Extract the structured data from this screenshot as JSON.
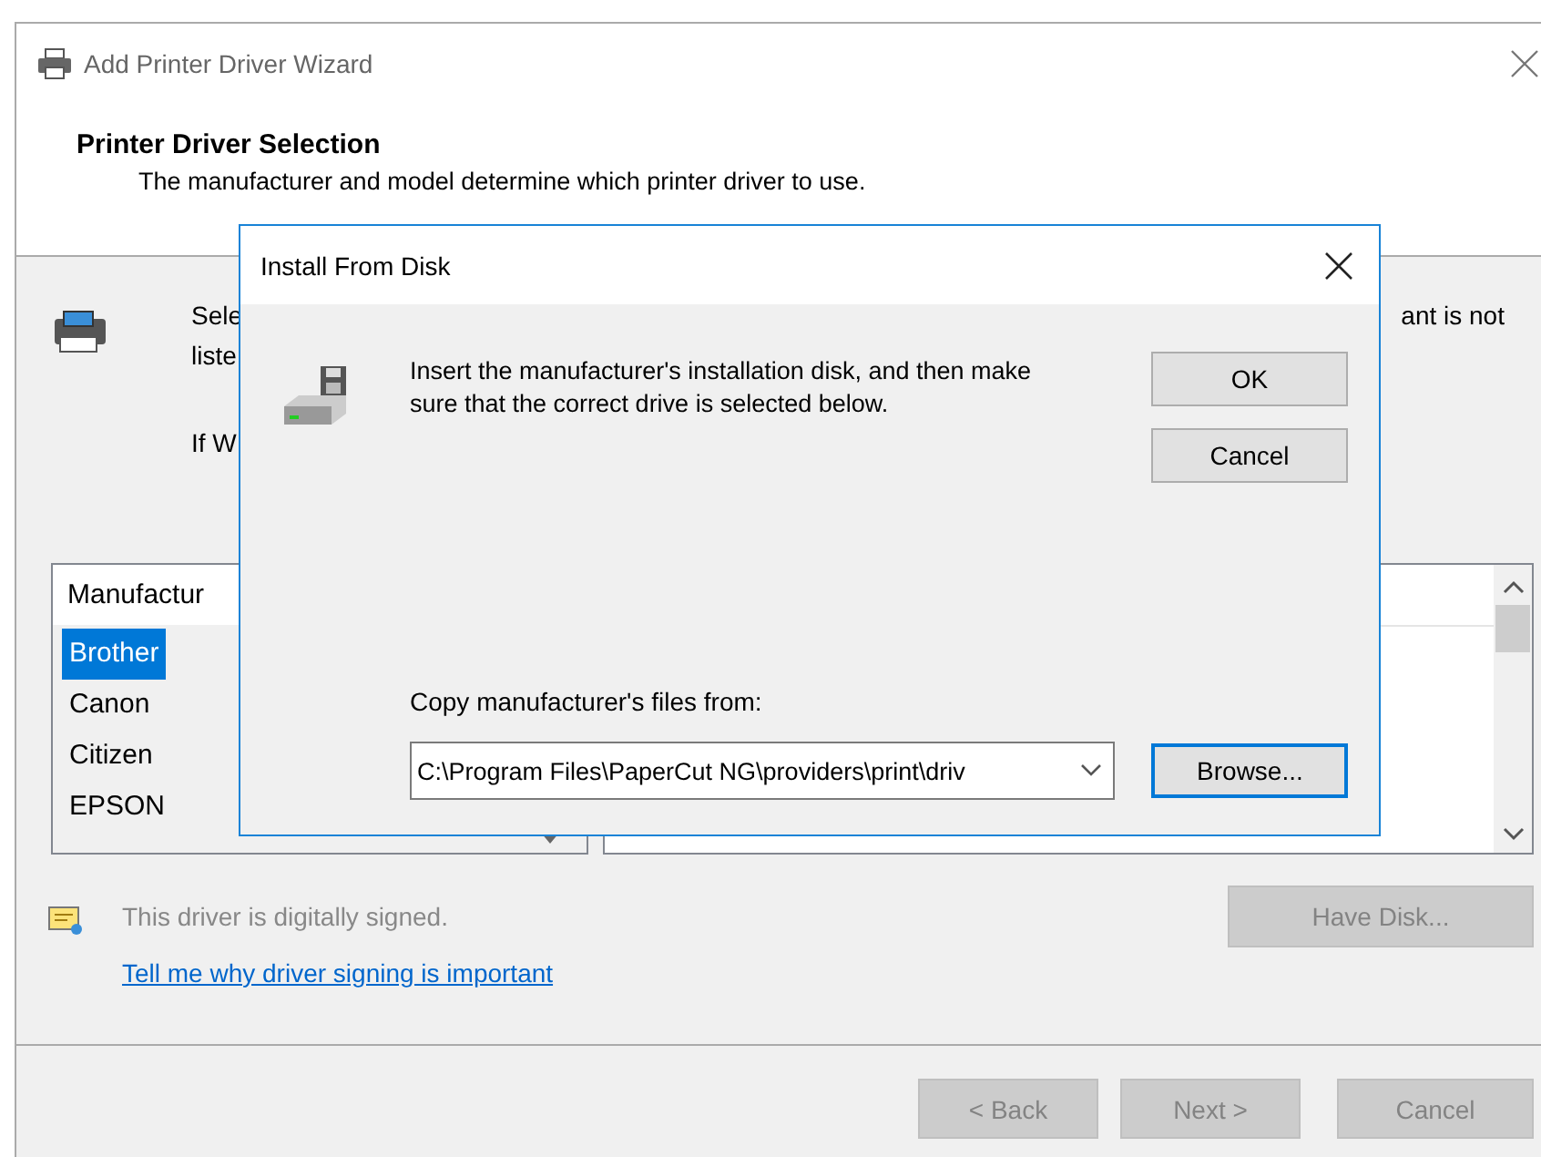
{
  "window": {
    "title": "Add Printer Driver Wizard"
  },
  "header": {
    "title": "Printer Driver Selection",
    "subtitle": "The manufacturer and model determine which printer driver to use."
  },
  "instructions": {
    "line_1_start": "Sele",
    "line_1_end": "ant is not",
    "line_2": "liste",
    "line_3": "If W"
  },
  "manufacturer_list": {
    "heading": "Manufactur",
    "items": [
      {
        "label": "Brother",
        "selected": true
      },
      {
        "label": "Canon",
        "selected": false
      },
      {
        "label": "Citizen",
        "selected": false
      },
      {
        "label": "EPSON",
        "selected": false
      }
    ]
  },
  "signature": {
    "text": "This driver is digitally signed.",
    "link": "Tell me why driver signing is important"
  },
  "have_disk_button": {
    "label": "Have Disk...",
    "disabled": true
  },
  "footer_buttons": [
    {
      "label": "< Back",
      "disabled": true
    },
    {
      "label": "Next >",
      "disabled": true
    },
    {
      "label": "Cancel",
      "disabled": true
    }
  ],
  "dialog": {
    "title": "Install From Disk",
    "message": "Insert the manufacturer's installation disk, and then make sure that the correct drive is selected below.",
    "buttons": [
      {
        "label": "OK",
        "focused": false
      },
      {
        "label": "Cancel",
        "focused": false
      }
    ],
    "path_label": "Copy manufacturer's files from:",
    "path_value": "C:\\Program Files\\PaperCut NG\\providers\\print\\driv",
    "browse_button": {
      "label": "Browse...",
      "focused": true
    }
  }
}
